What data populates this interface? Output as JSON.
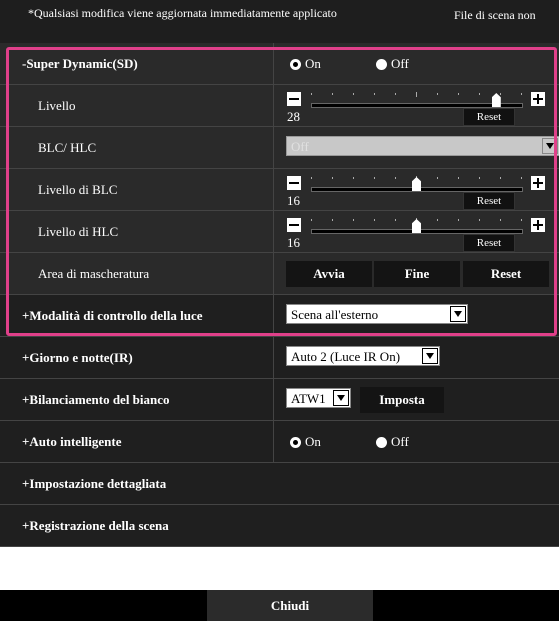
{
  "notice": {
    "message": "*Qualsiasi modifica viene aggiornata immediatamente applicato",
    "right": "File di scena non"
  },
  "sd": {
    "label": "-Super Dynamic(SD)",
    "on": "On",
    "off": "Off",
    "selected": "on"
  },
  "livello": {
    "label": "Livello",
    "value": "28",
    "reset": "Reset"
  },
  "blc_hlc": {
    "label": "BLC/ HLC",
    "value": "Off"
  },
  "livello_blc": {
    "label": "Livello di BLC",
    "value": "16",
    "reset": "Reset"
  },
  "livello_hlc": {
    "label": "Livello di HLC",
    "value": "16",
    "reset": "Reset"
  },
  "mask": {
    "label": "Area di mascheratura",
    "start": "Avvia",
    "end": "Fine",
    "reset": "Reset"
  },
  "light": {
    "label": "+Modalità di controllo della luce",
    "value": "Scena all'esterno"
  },
  "daynight": {
    "label": "+Giorno e notte(IR)",
    "value": "Auto 2 (Luce IR On)"
  },
  "wb": {
    "label": "+Bilanciamento del bianco",
    "value": "ATW1",
    "set": "Imposta"
  },
  "ai": {
    "label": "+Auto intelligente",
    "on": "On",
    "off": "Off",
    "selected": "on"
  },
  "detail": {
    "label": "+Impostazione dettagliata"
  },
  "scene": {
    "label": "+Registrazione della scena"
  },
  "footer": {
    "close": "Chiudi"
  },
  "colors": {
    "highlight": "#e0408a",
    "panel": "#2a2a2a"
  },
  "sliders": {
    "livello_fraction": 0.88,
    "blc_fraction": 0.5,
    "hlc_fraction": 0.5
  }
}
